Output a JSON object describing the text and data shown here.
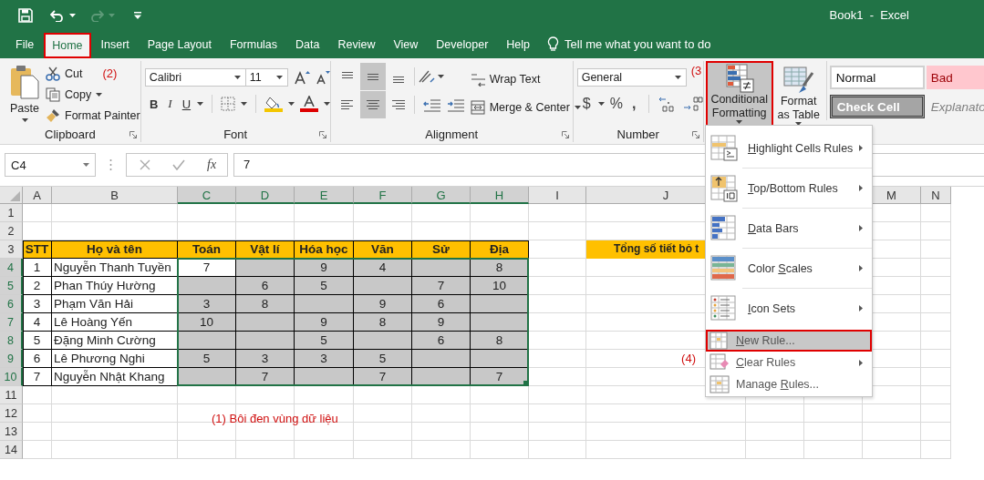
{
  "title_bar": {
    "title": "Book1  -  Excel",
    "redo_disabled": true
  },
  "tabs": [
    {
      "label": "File",
      "selected": false,
      "annotated": false
    },
    {
      "label": "Home",
      "selected": true,
      "annotated": true
    },
    {
      "label": "Insert",
      "selected": false,
      "annotated": false
    },
    {
      "label": "Page Layout",
      "selected": false,
      "annotated": false
    },
    {
      "label": "Formulas",
      "selected": false,
      "annotated": false
    },
    {
      "label": "Data",
      "selected": false,
      "annotated": false
    },
    {
      "label": "Review",
      "selected": false,
      "annotated": false
    },
    {
      "label": "View",
      "selected": false,
      "annotated": false
    },
    {
      "label": "Developer",
      "selected": false,
      "annotated": false
    },
    {
      "label": "Help",
      "selected": false,
      "annotated": false
    }
  ],
  "tell_me": "Tell me what you want to do",
  "ribbon": {
    "clipboard": {
      "label": "Clipboard",
      "paste": "Paste",
      "cut": "Cut",
      "copy": "Copy",
      "format_painter": "Format Painter",
      "note": "(2)"
    },
    "font": {
      "label": "Font",
      "font_name": "Calibri",
      "font_size": "11",
      "bold": "B",
      "italic": "I",
      "underline": "U"
    },
    "alignment": {
      "label": "Alignment",
      "wrap_text": "Wrap Text",
      "merge": "Merge & Center",
      "buttons": [
        {
          "kind": "top",
          "selected": false
        },
        {
          "kind": "middle",
          "selected": true
        },
        {
          "kind": "bottom",
          "selected": false
        },
        {
          "kind": "left",
          "selected": false
        },
        {
          "kind": "center",
          "selected": true
        },
        {
          "kind": "right",
          "selected": false
        }
      ]
    },
    "number": {
      "label": "Number",
      "format": "General",
      "currency": "$",
      "percent": "%",
      "comma": ","
    },
    "styles": {
      "note": "(3",
      "conditional": {
        "label": "Conditional Formatting",
        "selected": true,
        "annotated": true
      },
      "format_table": "Format as Table",
      "cell_styles": [
        {
          "label": "Normal",
          "kind": "normal"
        },
        {
          "label": "Bad",
          "kind": "bad"
        },
        {
          "label": "Check Cell",
          "kind": "check"
        },
        {
          "label": "Explanato",
          "kind": "explanatory"
        }
      ]
    }
  },
  "formula_bar": {
    "name_box": "C4",
    "fx": "fx",
    "value": "7"
  },
  "sheet": {
    "columns": [
      {
        "label": "A",
        "selected": false
      },
      {
        "label": "B",
        "selected": false
      },
      {
        "label": "C",
        "selected": true
      },
      {
        "label": "D",
        "selected": true
      },
      {
        "label": "E",
        "selected": true
      },
      {
        "label": "F",
        "selected": true
      },
      {
        "label": "G",
        "selected": true
      },
      {
        "label": "H",
        "selected": true
      },
      {
        "label": "I",
        "selected": false
      },
      {
        "label": "J",
        "selected": false
      },
      {},
      {},
      {
        "label": "M",
        "selected": false
      },
      {
        "label": "N",
        "selected": false
      }
    ],
    "rows": [
      {
        "number": "1",
        "selected": false
      },
      {
        "number": "2",
        "selected": false
      },
      {
        "number": "3",
        "selected": false,
        "cells": [
          {
            "text": "STT",
            "kind": "header"
          },
          {
            "text": "Họ và tên",
            "kind": "header"
          },
          {
            "text": "Toán",
            "kind": "header"
          },
          {
            "text": "Vật lí",
            "kind": "header"
          },
          {
            "text": "Hóa học",
            "kind": "header"
          },
          {
            "text": "Văn",
            "kind": "header"
          },
          {
            "text": "Sử",
            "kind": "header"
          },
          {
            "text": "Địa",
            "kind": "header"
          },
          {
            "kind": "plain"
          },
          {
            "text": "Tổng số tiết bỏ t",
            "kind": "header"
          }
        ]
      },
      {
        "number": "4",
        "selected": true,
        "cells": [
          {
            "text": "1",
            "kind": "index"
          },
          {
            "text": "Nguyễn Thanh Tuyền",
            "kind": "name"
          },
          {
            "text": "7",
            "kind": "score",
            "active": true
          },
          {
            "kind": "score",
            "active": false
          },
          {
            "text": "9",
            "kind": "score",
            "active": false
          },
          {
            "text": "4",
            "kind": "score",
            "active": false
          },
          {
            "kind": "score",
            "active": false
          },
          {
            "text": "8",
            "kind": "score",
            "active": false
          }
        ]
      },
      {
        "number": "5",
        "selected": true,
        "cells": [
          {
            "text": "2",
            "kind": "index"
          },
          {
            "text": "Phan Thúy Hường",
            "kind": "name"
          },
          {
            "kind": "score",
            "active": false
          },
          {
            "text": "6",
            "kind": "score",
            "active": false
          },
          {
            "text": "5",
            "kind": "score",
            "active": false
          },
          {
            "kind": "score",
            "active": false
          },
          {
            "text": "7",
            "kind": "score",
            "active": false
          },
          {
            "text": "10",
            "kind": "score",
            "active": false
          }
        ]
      },
      {
        "number": "6",
        "selected": true,
        "cells": [
          {
            "text": "3",
            "kind": "index"
          },
          {
            "text": "Phạm Văn Hải",
            "kind": "name"
          },
          {
            "text": "3",
            "kind": "score",
            "active": false
          },
          {
            "text": "8",
            "kind": "score",
            "active": false
          },
          {
            "kind": "score",
            "active": false
          },
          {
            "text": "9",
            "kind": "score",
            "active": false
          },
          {
            "text": "6",
            "kind": "score",
            "active": false
          },
          {
            "kind": "score",
            "active": false
          }
        ]
      },
      {
        "number": "7",
        "selected": true,
        "cells": [
          {
            "text": "4",
            "kind": "index"
          },
          {
            "text": "Lê Hoàng Yến",
            "kind": "name"
          },
          {
            "text": "10",
            "kind": "score",
            "active": false
          },
          {
            "kind": "score",
            "active": false
          },
          {
            "text": "9",
            "kind": "score",
            "active": false
          },
          {
            "text": "8",
            "kind": "score",
            "active": false
          },
          {
            "text": "9",
            "kind": "score",
            "active": false
          },
          {
            "kind": "score",
            "active": false
          }
        ]
      },
      {
        "number": "8",
        "selected": true,
        "cells": [
          {
            "text": "5",
            "kind": "index"
          },
          {
            "text": "Đặng Minh Cường",
            "kind": "name"
          },
          {
            "kind": "score",
            "active": false
          },
          {
            "kind": "score",
            "active": false
          },
          {
            "text": "5",
            "kind": "score",
            "active": false
          },
          {
            "kind": "score",
            "active": false
          },
          {
            "text": "6",
            "kind": "score",
            "active": false
          },
          {
            "text": "8",
            "kind": "score",
            "active": false
          }
        ]
      },
      {
        "number": "9",
        "selected": true,
        "cells": [
          {
            "text": "6",
            "kind": "index"
          },
          {
            "text": "Lê Phương Nghi",
            "kind": "name"
          },
          {
            "text": "5",
            "kind": "score",
            "active": false
          },
          {
            "text": "3",
            "kind": "score",
            "active": false
          },
          {
            "text": "3",
            "kind": "score",
            "active": false
          },
          {
            "text": "5",
            "kind": "score",
            "active": false
          },
          {
            "kind": "score",
            "active": false
          },
          {
            "kind": "score",
            "active": false
          }
        ]
      },
      {
        "number": "10",
        "selected": true,
        "cells": [
          {
            "text": "7",
            "kind": "index"
          },
          {
            "text": "Nguyễn Nhật Khang",
            "kind": "name"
          },
          {
            "kind": "score",
            "active": false
          },
          {
            "text": "7",
            "kind": "score",
            "active": false
          },
          {
            "kind": "score",
            "active": false
          },
          {
            "text": "7",
            "kind": "score",
            "active": false
          },
          {
            "kind": "score",
            "active": false
          },
          {
            "text": "7",
            "kind": "score",
            "active": false
          }
        ]
      },
      {
        "number": "11",
        "selected": false
      },
      {
        "number": "12",
        "selected": false
      },
      {
        "number": "13",
        "selected": false
      },
      {
        "number": "14",
        "selected": false
      }
    ],
    "selection_note": "(1) Bôi đen vùng dữ liệu",
    "menu_note": "(4)"
  },
  "menu": {
    "items": [
      {
        "kind": "highlight",
        "access_key": "H",
        "label_end": "ighlight Cells Rules",
        "submenu": true,
        "selected": false,
        "annotated": false
      },
      {
        "kind": "top_bottom",
        "access_key": "T",
        "label_end": "op/Bottom Rules",
        "submenu": true,
        "selected": false,
        "annotated": false
      },
      {
        "kind": "data_bars",
        "access_key": "D",
        "label_end": "ata Bars",
        "submenu": true,
        "selected": false,
        "annotated": false
      },
      {
        "kind": "color_scales",
        "label_start": "Color ",
        "access_key": "S",
        "label_end": "cales",
        "submenu": true,
        "selected": false,
        "annotated": false
      },
      {
        "kind": "icon_sets",
        "access_key": "I",
        "label_end": "con Sets",
        "submenu": true,
        "selected": false,
        "annotated": false
      },
      {
        "kind": "new_rule",
        "access_key": "N",
        "label_end": "ew Rule...",
        "submenu": false,
        "selected": true,
        "annotated": true
      },
      {
        "kind": "clear_rules",
        "access_key": "C",
        "label_end": "lear Rules",
        "submenu": true,
        "selected": false,
        "annotated": false
      },
      {
        "kind": "manage_rules",
        "label_start": "Manage ",
        "access_key": "R",
        "label_end": "ules...",
        "submenu": false,
        "selected": false,
        "annotated": false
      }
    ]
  }
}
